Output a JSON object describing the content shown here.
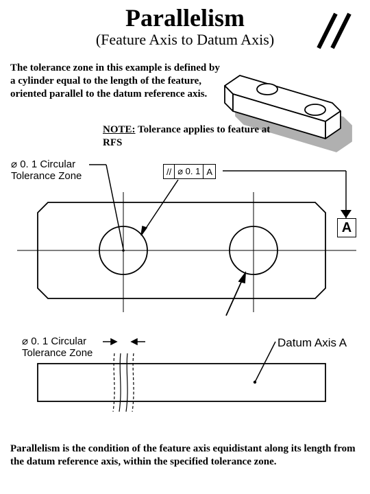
{
  "title": "Parallelism",
  "subtitle": "(Feature Axis to Datum Axis)",
  "intro": "The tolerance zone in this example is defined by a cylinder equal to the length of the feature, oriented parallel to the datum reference axis.",
  "note_lead": "NOTE:",
  "note_rest": " Tolerance applies to feature at RFS",
  "tolerance_zone_label": "⌀ 0. 1 Circular\nTolerance Zone",
  "datum_axis_label": "Datum Axis A",
  "datum_box": "A",
  "fcf": {
    "sym": "//",
    "tol": "⌀ 0. 1",
    "datum": "A"
  },
  "bottom": "Parallelism is the condition of the feature axis equidistant along its length from the datum reference axis, within the specified tolerance zone."
}
